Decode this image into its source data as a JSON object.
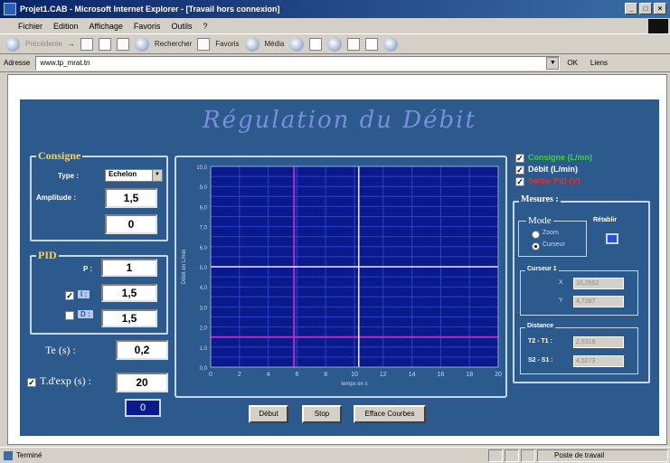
{
  "window": {
    "title": "Projet1.CAB - Microsoft Internet Explorer - [Travail hors connexion]",
    "buttons": {
      "minimize": "_",
      "maximize": "□",
      "close": "×"
    }
  },
  "menu": [
    "Fichier",
    "Edition",
    "Affichage",
    "Favoris",
    "Outils",
    "?"
  ],
  "toolbar": {
    "back": "Précédente",
    "search": "Rechercher",
    "favorites": "Favoris",
    "media": "Média"
  },
  "address": {
    "label": "Adresse",
    "value": "www.tp_mrat.tn",
    "ok": "OK",
    "links": "Liens"
  },
  "app": {
    "title": "Régulation du Débit",
    "consigne": {
      "title": "Consigne",
      "type_label": "Type :",
      "type_value": "Echelon",
      "amplitude_label": "Amplitude :",
      "amplitude_value": "1,5",
      "offset_value": "0"
    },
    "pid": {
      "title": "PID",
      "p_label": "P :",
      "p_value": "1",
      "i_label": "I :",
      "i_value": "1,5",
      "d_label": "D :",
      "d_value": "1,5",
      "i_checked": true,
      "d_checked": false
    },
    "te_label": "Te (s) :",
    "te_value": "0,2",
    "texp_label": "T.d'exp (s) :",
    "texp_value": "20",
    "texp_checked": true,
    "counter_value": "0",
    "buttons": {
      "start": "Début",
      "stop": "Stop",
      "clear": "Efface Courbes"
    },
    "legend": [
      {
        "label": "Consigne (L/mn)",
        "color": "#3cd43c",
        "checked": true
      },
      {
        "label": "Débit (L/min)",
        "color": "#ffffff",
        "checked": true
      },
      {
        "label": "Sortie PID (V)",
        "color": "#e03030",
        "checked": true
      }
    ],
    "mesures": {
      "title": "Mesures :",
      "mode_title": "Mode",
      "mode_options": [
        "Zoom",
        "Curseur"
      ],
      "mode_selected": 1,
      "retablir_label": "Rétablir",
      "curseur": {
        "title": "Curseur 1",
        "x_label": "X",
        "x_value": "10,2552",
        "y_label": "Y",
        "y_value": "4,7287"
      },
      "distance": {
        "title": "Distance",
        "t_label": "T2 - T1 :",
        "t_value": "2,5318",
        "s_label": "S2 - S1 :",
        "s_value": "4,5273"
      }
    }
  },
  "chart_data": {
    "type": "line",
    "title": "",
    "xlabel": "temps en s",
    "ylabel": "Débit en L/min",
    "xlim": [
      0,
      20
    ],
    "ylim": [
      0,
      10
    ],
    "xticks": [
      "0",
      "2",
      "4",
      "6",
      "8",
      "10",
      "12",
      "14",
      "16",
      "18",
      "20"
    ],
    "yticks": [
      "0,0",
      "1,0",
      "2,0",
      "3,0",
      "4,0",
      "5,0",
      "6,0",
      "7,0",
      "8,0",
      "9,0",
      "10,0"
    ],
    "background": "#0a1a8c",
    "grid": true,
    "series": [],
    "cursor": {
      "x": 10.3,
      "y": 5.0
    },
    "marker_x": 5.8,
    "marker_y": 1.5
  },
  "status": {
    "text": "Terminé",
    "zone": "Poste de travail"
  }
}
